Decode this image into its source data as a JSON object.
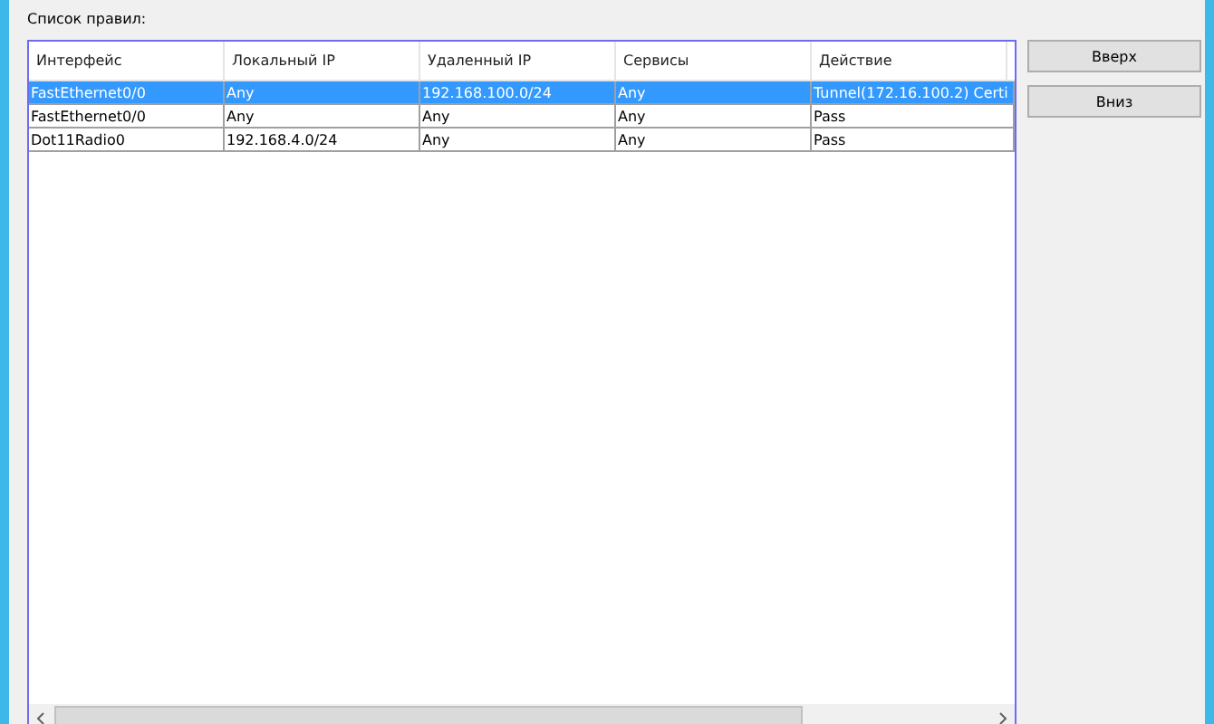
{
  "title": "Список правил:",
  "table": {
    "columns": [
      "Интерфейс",
      "Локальный IP",
      "Удаленный IP",
      "Сервисы",
      "Действие"
    ],
    "rows": [
      {
        "cells": [
          "FastEthernet0/0",
          "Any",
          "192.168.100.0/24",
          "Any",
          "Tunnel(172.16.100.2) Certi"
        ],
        "selected": true
      },
      {
        "cells": [
          "FastEthernet0/0",
          "Any",
          "Any",
          "Any",
          "Pass"
        ],
        "selected": false
      },
      {
        "cells": [
          "Dot11Radio0",
          "192.168.4.0/24",
          "Any",
          "Any",
          "Pass"
        ],
        "selected": false
      }
    ]
  },
  "buttons": [
    "Вверх",
    "Вниз"
  ]
}
